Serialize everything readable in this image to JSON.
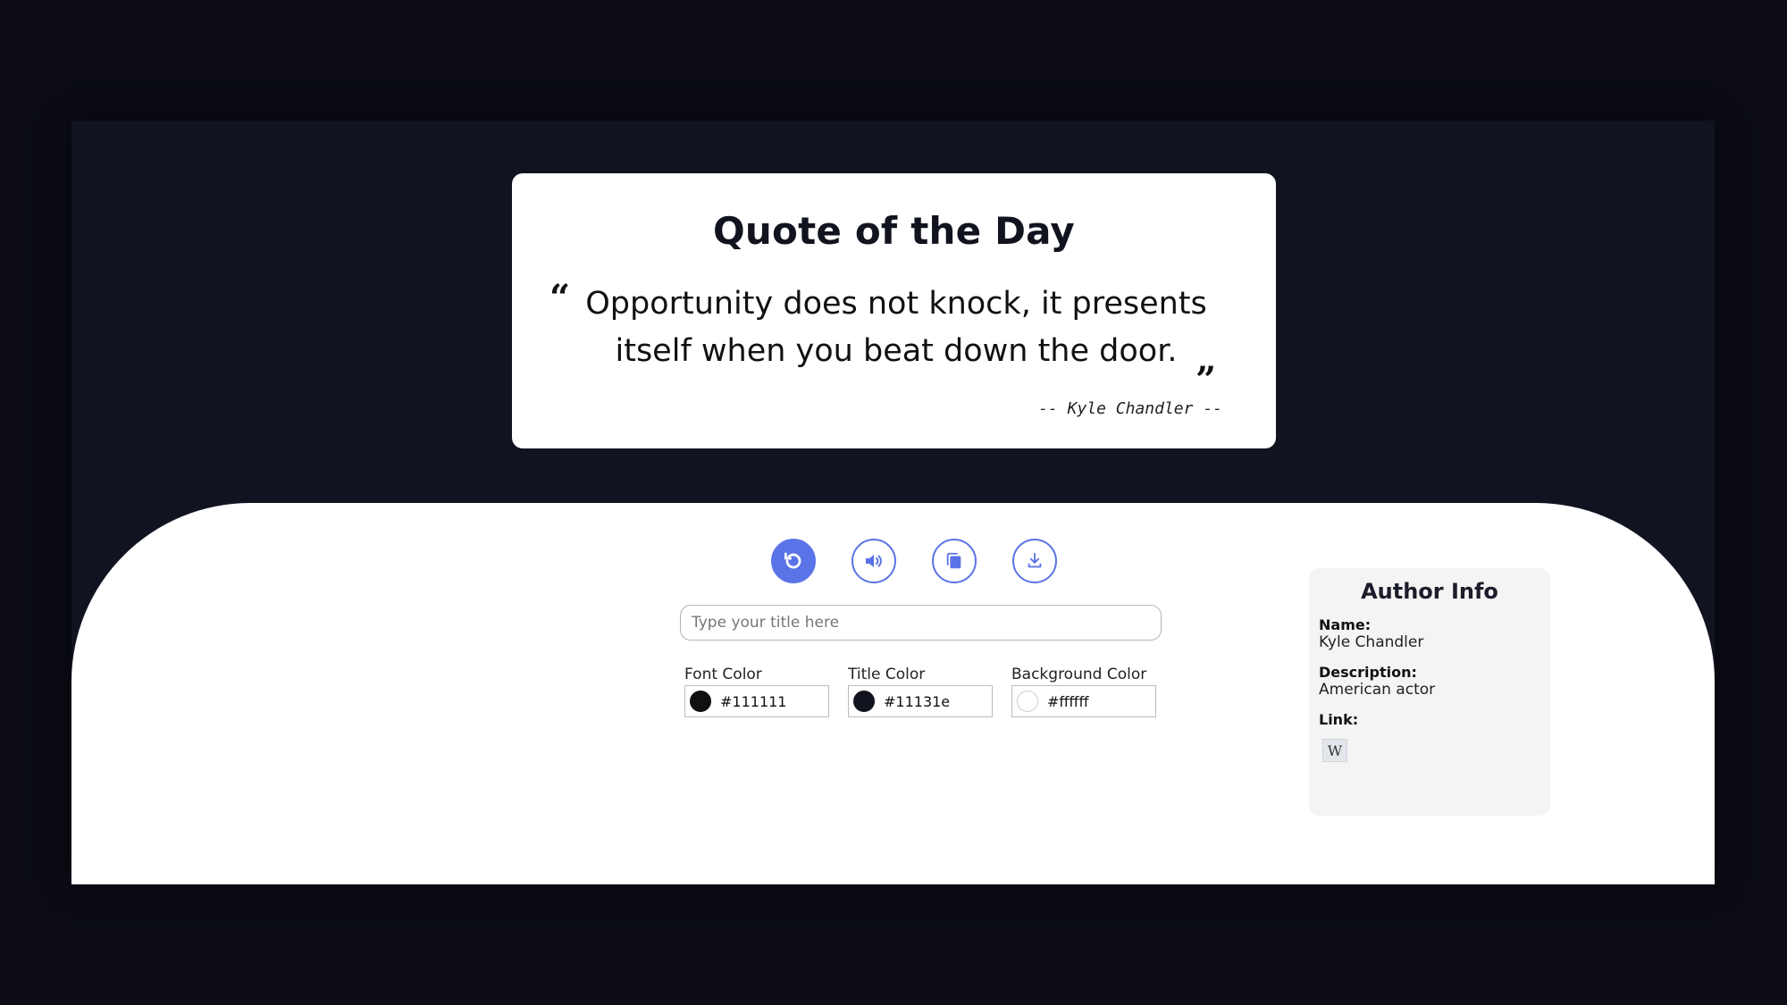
{
  "quote_card": {
    "title": "Quote of the Day",
    "open_mark": "“",
    "close_mark": "”",
    "text": "Opportunity does not knock, it presents itself when you beat down the door.",
    "author_line": "-- Kyle Chandler --"
  },
  "toolbar": {
    "buttons": [
      {
        "icon": "refresh-icon",
        "active": true
      },
      {
        "icon": "speaker-icon",
        "active": false
      },
      {
        "icon": "copy-icon",
        "active": false
      },
      {
        "icon": "download-icon",
        "active": false
      }
    ],
    "accent_color": "#5a73e6"
  },
  "title_input": {
    "placeholder": "Type your title here",
    "value": ""
  },
  "colors": {
    "font": {
      "label": "Font Color",
      "value": "#111111",
      "swatch": "#111111"
    },
    "title": {
      "label": "Title Color",
      "value": "#11131e",
      "swatch": "#11131e"
    },
    "background": {
      "label": "Background Color",
      "value": "#ffffff",
      "swatch": "#ffffff"
    }
  },
  "author_info": {
    "heading": "Author Info",
    "name_label": "Name:",
    "name": "Kyle Chandler",
    "description_label": "Description:",
    "description": "American actor",
    "link_label": "Link:",
    "link_icon": "wikipedia-icon",
    "link_glyph": "W"
  }
}
